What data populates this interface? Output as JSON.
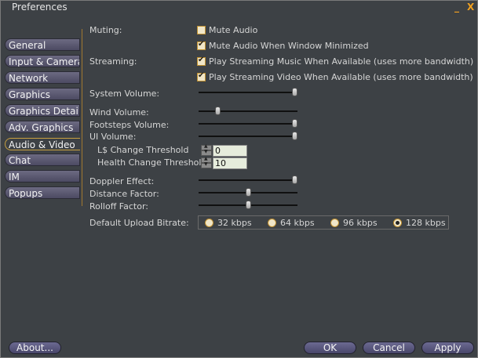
{
  "window": {
    "title": "Preferences",
    "minimize_glyph": "_",
    "close_glyph": "X"
  },
  "tabs": [
    {
      "label": "General"
    },
    {
      "label": "Input & Camera"
    },
    {
      "label": "Network"
    },
    {
      "label": "Graphics"
    },
    {
      "label": "Graphics Detail"
    },
    {
      "label": "Adv. Graphics"
    },
    {
      "label": "Audio & Video"
    },
    {
      "label": "Chat"
    },
    {
      "label": "IM"
    },
    {
      "label": "Popups"
    }
  ],
  "active_tab": "Audio & Video",
  "muting": {
    "label": "Muting:",
    "mute_audio": {
      "label": "Mute Audio",
      "checked": false
    },
    "mute_minimized": {
      "label": "Mute Audio When Window Minimized",
      "checked": true
    }
  },
  "streaming": {
    "label": "Streaming:",
    "music": {
      "label": "Play Streaming Music When Available (uses more bandwidth)",
      "checked": true
    },
    "video": {
      "label": "Play Streaming Video When Available (uses more bandwidth)",
      "checked": true
    }
  },
  "sliders": {
    "system_volume": {
      "label": "System Volume:",
      "value": 1.0
    },
    "wind_volume": {
      "label": "Wind Volume:",
      "value": 0.18
    },
    "footsteps_volume": {
      "label": "Footsteps Volume:",
      "value": 1.0
    },
    "ui_volume": {
      "label": "UI Volume:",
      "value": 1.0
    },
    "doppler_effect": {
      "label": "Doppler Effect:",
      "value": 1.0
    },
    "distance_factor": {
      "label": "Distance Factor:",
      "value": 0.5
    },
    "rolloff_factor": {
      "label": "Rolloff Factor:",
      "value": 0.5
    }
  },
  "thresholds": {
    "lindens": {
      "label": "L$ Change Threshold",
      "value": "0"
    },
    "health": {
      "label": "Health Change Threshold",
      "value": "10"
    }
  },
  "bitrate": {
    "label": "Default Upload Bitrate:",
    "options": [
      "32 kbps",
      "64 kbps",
      "96 kbps",
      "128 kbps"
    ],
    "selected": "128 kbps"
  },
  "buttons": {
    "about": "About...",
    "ok": "OK",
    "cancel": "Cancel",
    "apply": "Apply"
  }
}
